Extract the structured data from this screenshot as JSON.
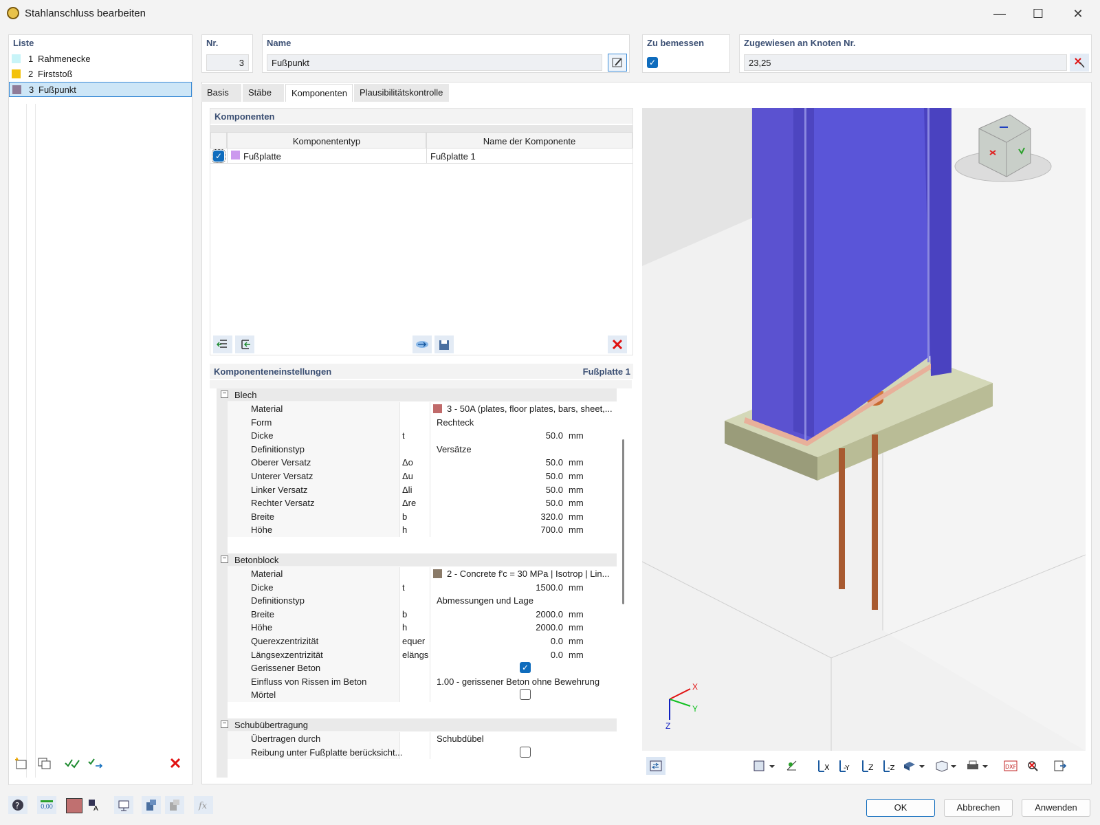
{
  "window": {
    "title": "Stahlanschluss bearbeiten",
    "minimize": "—",
    "maximize": "☐",
    "close": "✕"
  },
  "list": {
    "header": "Liste",
    "items": [
      {
        "num": "1",
        "label": "Rahmenecke",
        "color": "#c8f4f8"
      },
      {
        "num": "2",
        "label": "Firststoß",
        "color": "#f3c20c"
      },
      {
        "num": "3",
        "label": "Fußpunkt",
        "color": "#8f7b98"
      }
    ]
  },
  "nr": {
    "label": "Nr.",
    "value": "3"
  },
  "name": {
    "label": "Name",
    "value": "Fußpunkt"
  },
  "design": {
    "label": "Zu bemessen",
    "checked": true
  },
  "assigned": {
    "label": "Zugewiesen an Knoten Nr.",
    "value": "23,25"
  },
  "tabs": [
    "Basis",
    "Stäbe",
    "Komponenten",
    "Plausibilitätskontrolle"
  ],
  "components": {
    "header": "Komponenten",
    "col_type": "Komponententyp",
    "col_name": "Name der Komponente",
    "rows": [
      {
        "type": "Fußplatte",
        "name": "Fußplatte 1",
        "color": "#cc99ee"
      }
    ]
  },
  "settings": {
    "header": "Komponenteneinstellungen",
    "current": "Fußplatte 1",
    "blech": {
      "title": "Blech",
      "rows": [
        {
          "label": "Material",
          "sym": "",
          "val": "3 - 50A (plates, floor plates, bars, sheet,...",
          "unit": "",
          "swatch": "#c06a6a"
        },
        {
          "label": "Form",
          "sym": "",
          "val": "Rechteck",
          "unit": ""
        },
        {
          "label": "Dicke",
          "sym": "t",
          "num": "50.0",
          "unit": "mm"
        },
        {
          "label": "Definitionstyp",
          "sym": "",
          "val": "Versätze",
          "unit": ""
        },
        {
          "label": "Oberer Versatz",
          "sym": "Δo",
          "num": "50.0",
          "unit": "mm"
        },
        {
          "label": "Unterer Versatz",
          "sym": "Δu",
          "num": "50.0",
          "unit": "mm"
        },
        {
          "label": "Linker Versatz",
          "sym": "Δli",
          "num": "50.0",
          "unit": "mm"
        },
        {
          "label": "Rechter Versatz",
          "sym": "Δre",
          "num": "50.0",
          "unit": "mm"
        },
        {
          "label": "Breite",
          "sym": "b",
          "num": "320.0",
          "unit": "mm"
        },
        {
          "label": "Höhe",
          "sym": "h",
          "num": "700.0",
          "unit": "mm"
        }
      ]
    },
    "beton": {
      "title": "Betonblock",
      "rows": [
        {
          "label": "Material",
          "sym": "",
          "val": "2 - Concrete f'c = 30 MPa | Isotrop | Lin...",
          "unit": "",
          "swatch": "#8a7a68"
        },
        {
          "label": "Dicke",
          "sym": "t",
          "num": "1500.0",
          "unit": "mm"
        },
        {
          "label": "Definitionstyp",
          "sym": "",
          "val": "Abmessungen und Lage",
          "unit": ""
        },
        {
          "label": "Breite",
          "sym": "b",
          "num": "2000.0",
          "unit": "mm"
        },
        {
          "label": "Höhe",
          "sym": "h",
          "num": "2000.0",
          "unit": "mm"
        },
        {
          "label": "Querexzentrizität",
          "sym": "equer",
          "num": "0.0",
          "unit": "mm"
        },
        {
          "label": "Längsexzentrizität",
          "sym": "elängs",
          "num": "0.0",
          "unit": "mm"
        },
        {
          "label": "Gerissener Beton",
          "sym": "",
          "check": true
        },
        {
          "label": "Einfluss von Rissen im Beton",
          "sym": "",
          "val": "1.00 - gerissener Beton ohne Bewehrung",
          "unit": ""
        },
        {
          "label": "Mörtel",
          "sym": "",
          "check": false
        }
      ]
    },
    "schub": {
      "title": "Schubübertragung",
      "rows": [
        {
          "label": "Übertragen durch",
          "sym": "",
          "val": "Schubdübel",
          "unit": ""
        },
        {
          "label": "Reibung unter Fußplatte berücksicht...",
          "sym": "",
          "check": false
        }
      ]
    }
  },
  "axes": {
    "x": "X",
    "y": "Y",
    "z": "Z"
  },
  "buttons": {
    "ok": "OK",
    "cancel": "Abbrechen",
    "apply": "Anwenden"
  },
  "bottom_value": "0,00"
}
